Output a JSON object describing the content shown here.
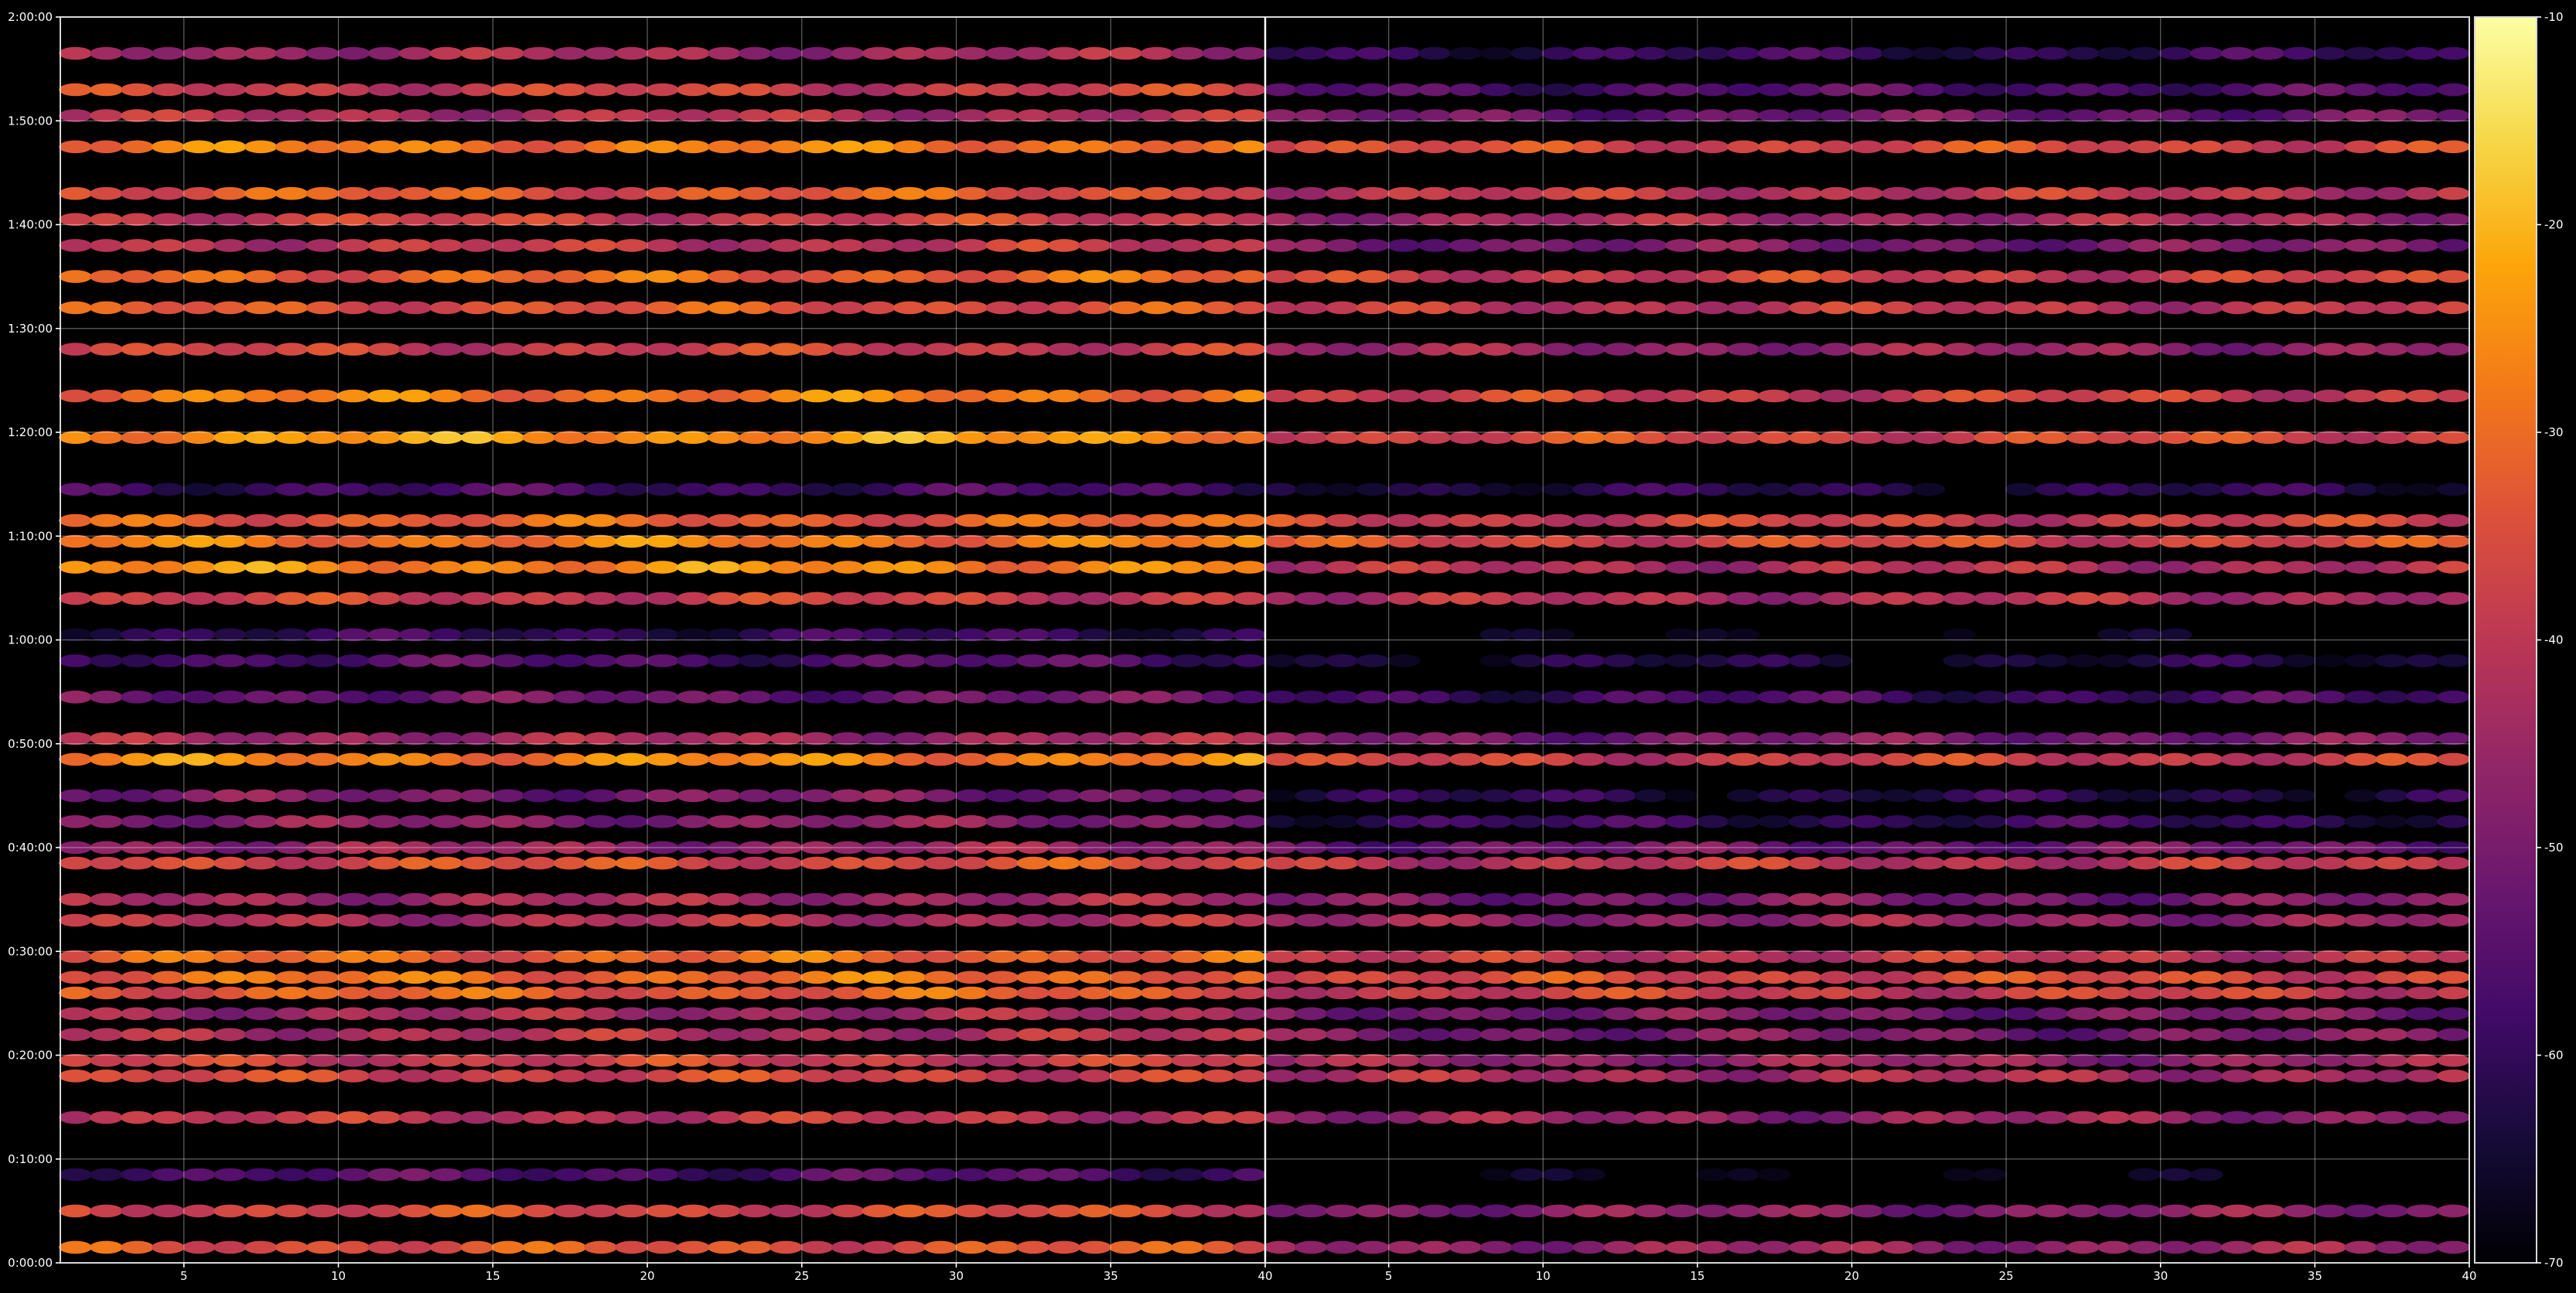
{
  "chart_data": {
    "type": "heatmap",
    "title": "",
    "xlabel": "",
    "ylabel": "",
    "colormap": "inferno",
    "background": "#000000",
    "grid": true,
    "panels": [
      {
        "name": "",
        "xlim": [
          1,
          40
        ],
        "x_ticks": [
          5,
          10,
          15,
          20,
          25,
          30,
          35,
          40
        ],
        "x_tick_labels": [
          "5",
          "10",
          "15",
          "20",
          "25",
          "30",
          "35",
          "40"
        ]
      },
      {
        "name": "",
        "xlim": [
          1,
          40
        ],
        "x_ticks": [
          5,
          10,
          15,
          20,
          25,
          30,
          35,
          40
        ],
        "x_tick_labels": [
          "5",
          "10",
          "15",
          "20",
          "25",
          "30",
          "35",
          "40"
        ]
      }
    ],
    "y_axis": {
      "units": "h:mm:ss",
      "range": [
        "0:00:00",
        "2:00:00"
      ],
      "ticks": [
        "0:00:00",
        "0:10:00",
        "0:20:00",
        "0:30:00",
        "0:40:00",
        "0:50:00",
        "1:00:00",
        "1:10:00",
        "1:20:00",
        "1:30:00",
        "1:40:00",
        "1:50:00",
        "2:00:00"
      ],
      "tick_labels": [
        "0:00:00",
        "0:10:00",
        "0:20:00",
        "0:30:00",
        "0:40:00",
        "0:50:00",
        "1:00:00",
        "1:10:00",
        "1:20:00",
        "1:30:00",
        "1:40:00",
        "1:50:00",
        "2:00:00"
      ]
    },
    "colorbar": {
      "range": [
        -70,
        -10
      ],
      "ticks": [
        -70,
        -60,
        -50,
        -40,
        -30,
        -20,
        -10
      ],
      "tick_labels": [
        "-70",
        "-60",
        "-50",
        "-40",
        "-30",
        "-20",
        "-10"
      ]
    },
    "bands": [
      {
        "y_min": 1.5,
        "panel1": -34,
        "panel2": -46
      },
      {
        "y_min": 5,
        "panel1": -36,
        "panel2": -48
      },
      {
        "y_min": 8.5,
        "panel1": -56,
        "panel2": -70
      },
      {
        "y_min": 14,
        "panel1": -40,
        "panel2": -46
      },
      {
        "y_min": 18,
        "panel1": -37,
        "panel2": -43
      },
      {
        "y_min": 19.5,
        "panel1": -38,
        "panel2": -46
      },
      {
        "y_min": 22,
        "panel1": -42,
        "panel2": -50
      },
      {
        "y_min": 24,
        "panel1": -44,
        "panel2": -50
      },
      {
        "y_min": 26,
        "panel1": -32,
        "panel2": -38
      },
      {
        "y_min": 27.5,
        "panel1": -30,
        "panel2": -36
      },
      {
        "y_min": 29.5,
        "panel1": -31,
        "panel2": -40
      },
      {
        "y_min": 33,
        "panel1": -42,
        "panel2": -46
      },
      {
        "y_min": 35,
        "panel1": -44,
        "panel2": -50
      },
      {
        "y_min": 38.5,
        "panel1": -35,
        "panel2": -40
      },
      {
        "y_min": 40,
        "panel1": -46,
        "panel2": -52
      },
      {
        "y_min": 42.5,
        "panel1": -48,
        "panel2": -60
      },
      {
        "y_min": 45,
        "panel1": -50,
        "panel2": -62
      },
      {
        "y_min": 48.5,
        "panel1": -27,
        "panel2": -38
      },
      {
        "y_min": 50.5,
        "panel1": -44,
        "panel2": -50
      },
      {
        "y_min": 54.5,
        "panel1": -52,
        "panel2": -58
      },
      {
        "y_min": 58,
        "panel1": -56,
        "panel2": -64
      },
      {
        "y_min": 60.5,
        "panel1": -60,
        "panel2": -70
      },
      {
        "y_min": 64,
        "panel1": -38,
        "panel2": -42
      },
      {
        "y_min": 67,
        "panel1": -26,
        "panel2": -42
      },
      {
        "y_min": 69.5,
        "panel1": -28,
        "panel2": -36
      },
      {
        "y_min": 71.5,
        "panel1": -32,
        "panel2": -38
      },
      {
        "y_min": 74.5,
        "panel1": -58,
        "panel2": -62
      },
      {
        "y_min": 79.5,
        "panel1": -24,
        "panel2": -36
      },
      {
        "y_min": 83.5,
        "panel1": -28,
        "panel2": -38
      },
      {
        "y_min": 88,
        "panel1": -38,
        "panel2": -46
      },
      {
        "y_min": 92,
        "panel1": -34,
        "panel2": -40
      },
      {
        "y_min": 95,
        "panel1": -31,
        "panel2": -38
      },
      {
        "y_min": 98,
        "panel1": -40,
        "panel2": -50
      },
      {
        "y_min": 100.5,
        "panel1": -38,
        "panel2": -44
      },
      {
        "y_min": 103,
        "panel1": -33,
        "panel2": -40
      },
      {
        "y_min": 107.5,
        "panel1": -28,
        "panel2": -36
      },
      {
        "y_min": 110.5,
        "panel1": -42,
        "panel2": -52
      },
      {
        "y_min": 113,
        "panel1": -38,
        "panel2": -56
      },
      {
        "y_min": 116.5,
        "panel1": -44,
        "panel2": -60
      }
    ]
  }
}
